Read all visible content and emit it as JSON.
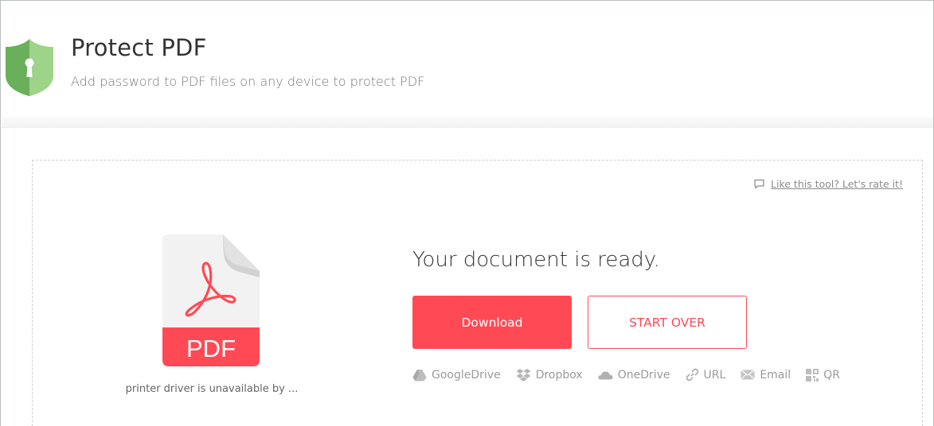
{
  "header": {
    "title": "Protect PDF",
    "subtitle": "Add password to PDF files on any device to protect PDF",
    "icon": "shield-lock-icon"
  },
  "rate_link": {
    "icon": "comment-icon",
    "label": "Like this tool? Let's rate it!"
  },
  "file": {
    "icon": "pdf-file-icon",
    "badge": "PDF",
    "name": "printer driver is unavailable by ..."
  },
  "result": {
    "message": "Your document is ready.",
    "download_label": "Download",
    "start_over_label": "START OVER"
  },
  "share": [
    {
      "icon": "google-drive-icon",
      "label": "GoogleDrive"
    },
    {
      "icon": "dropbox-icon",
      "label": "Dropbox"
    },
    {
      "icon": "onedrive-icon",
      "label": "OneDrive"
    },
    {
      "icon": "link-icon",
      "label": "URL"
    },
    {
      "icon": "email-icon",
      "label": "Email"
    },
    {
      "icon": "qr-code-icon",
      "label": "QR"
    }
  ],
  "colors": {
    "accent": "#ff4a55",
    "shield_dark": "#6ab05a",
    "shield_light": "#9dd48a",
    "muted_text": "#9a9a9a"
  }
}
